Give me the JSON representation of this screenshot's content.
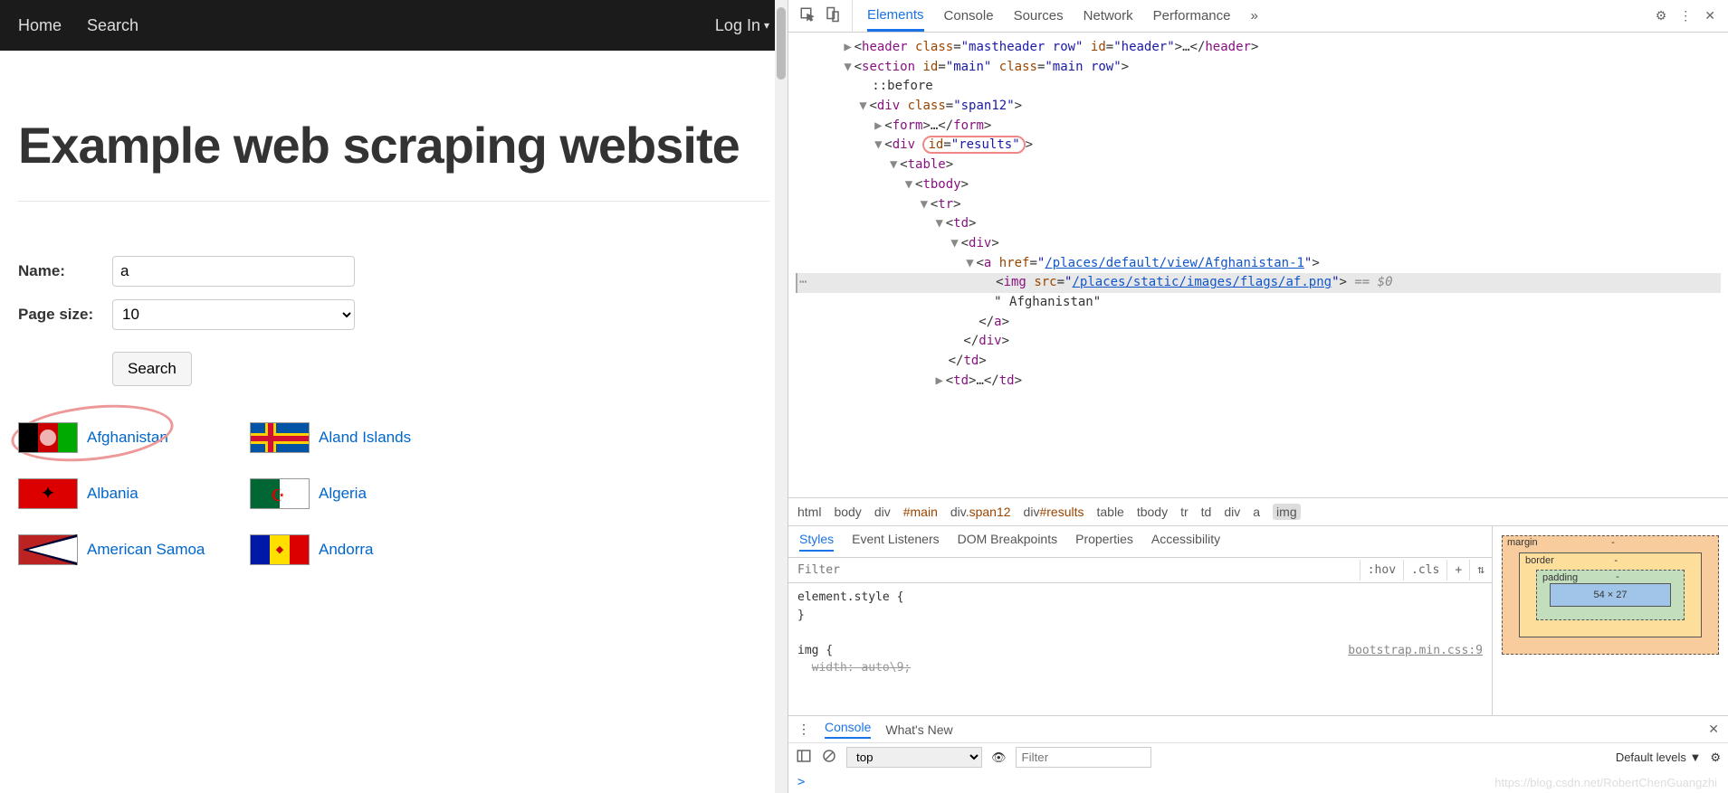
{
  "nav": {
    "home": "Home",
    "search": "Search",
    "login": "Log In"
  },
  "page": {
    "title": "Example web scraping website",
    "name_label": "Name:",
    "pagesize_label": "Page size:",
    "name_value": "a",
    "pagesize_value": "10",
    "search_btn": "Search"
  },
  "results": [
    {
      "name": "Afghanistan",
      "flag": "af"
    },
    {
      "name": "Aland Islands",
      "flag": "ax"
    },
    {
      "name": "Albania",
      "flag": "al"
    },
    {
      "name": "Algeria",
      "flag": "dz"
    },
    {
      "name": "American Samoa",
      "flag": "as"
    },
    {
      "name": "Andorra",
      "flag": "ad"
    }
  ],
  "devtools": {
    "tabs": [
      "Elements",
      "Console",
      "Sources",
      "Network",
      "Performance"
    ],
    "more": "»",
    "subtabs": [
      "Styles",
      "Event Listeners",
      "DOM Breakpoints",
      "Properties",
      "Accessibility"
    ],
    "filter_placeholder": "Filter",
    "hov": ":hov",
    "cls": ".cls",
    "console_tabs": [
      "Console",
      "What's New"
    ],
    "top": "top",
    "levels": "Default levels ▼",
    "prompt": ">",
    "sel_hint": "== $0"
  },
  "dom": {
    "l1": {
      "tag": "header",
      "attrs": "class=\"mastheader row\" id=\"header\""
    },
    "l2": {
      "tag": "section",
      "attrs": "id=\"main\" class=\"main row\""
    },
    "l3": "::before",
    "l4": {
      "tag": "div",
      "attrs": "class=\"span12\""
    },
    "l5": {
      "tag": "form"
    },
    "l6": {
      "tag": "div",
      "attrs_pre": "id=",
      "attrs_val": "\"results\""
    },
    "l7": {
      "tag": "table"
    },
    "l8": {
      "tag": "tbody"
    },
    "l9": {
      "tag": "tr"
    },
    "l10": {
      "tag": "td"
    },
    "l11": {
      "tag": "div"
    },
    "l12": {
      "tag": "a",
      "href": "/places/default/view/Afghanistan-1"
    },
    "l13": {
      "tag": "img",
      "src": "/places/static/images/flags/af.png"
    },
    "l14": "\" Afghanistan\"",
    "l15": "</a>",
    "l16": "</div>",
    "l17": "</td>",
    "l18": {
      "tag": "td"
    }
  },
  "crumbs": [
    "html",
    "body",
    "div",
    "#main",
    "div.span12",
    "div#results",
    "table",
    "tbody",
    "tr",
    "td",
    "div",
    "a",
    "img"
  ],
  "styles": {
    "s1": "element.style {",
    "s1b": "}",
    "s2": "img {",
    "s2src": "bootstrap.min.css:9",
    "s2rule": "width: auto\\9;"
  },
  "box": {
    "margin": "margin",
    "border": "border",
    "padding": "padding",
    "margin_v": "-",
    "border_v": "-",
    "padding_v": "-",
    "content": "54 × 27"
  },
  "watermark": "https://blog.csdn.net/RobertChenGuangzhi"
}
